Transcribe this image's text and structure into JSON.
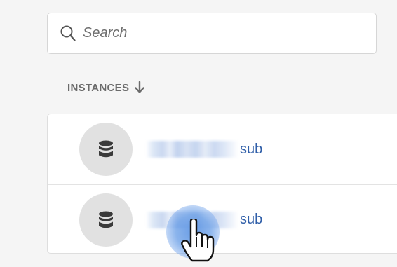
{
  "search": {
    "placeholder": "Search",
    "value": ""
  },
  "instances_header": {
    "label": "INSTANCES",
    "sort_icon": "arrow-down-icon"
  },
  "instances": [
    {
      "name_suffix": "sub",
      "icon": "database-icon"
    },
    {
      "name_suffix": "sub",
      "icon": "database-icon"
    }
  ],
  "cursor": {
    "icon": "hand-pointer-icon"
  },
  "colors": {
    "link": "#2f5ea8",
    "header_text": "#6b6b6b",
    "avatar_bg": "#e1e1e1",
    "icon": "#3a3a3a"
  }
}
